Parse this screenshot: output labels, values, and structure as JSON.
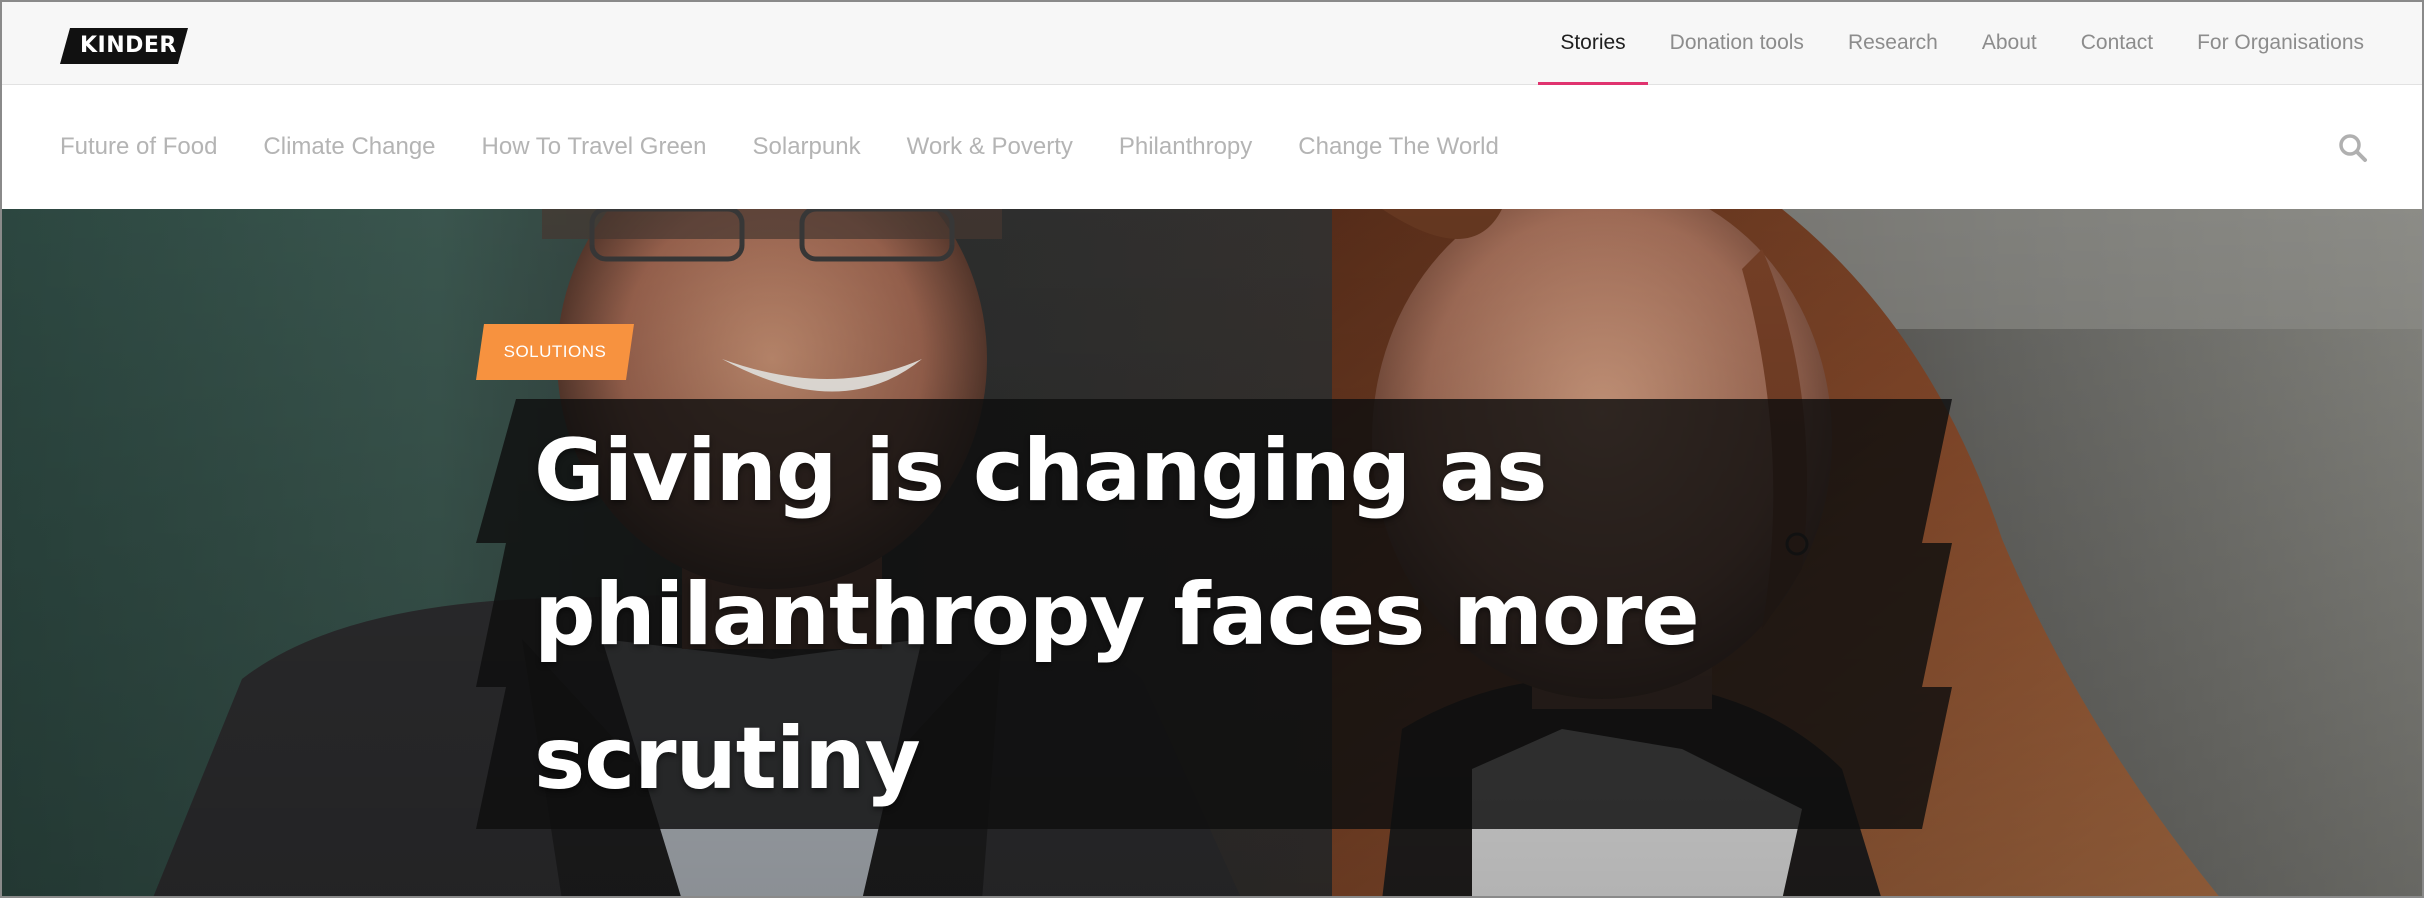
{
  "brand": {
    "logo_text": "KINDER"
  },
  "topnav": {
    "items": [
      {
        "label": "Stories",
        "active": true
      },
      {
        "label": "Donation tools",
        "active": false
      },
      {
        "label": "Research",
        "active": false
      },
      {
        "label": "About",
        "active": false
      },
      {
        "label": "Contact",
        "active": false
      },
      {
        "label": "For Organisations",
        "active": false
      }
    ]
  },
  "categories": {
    "items": [
      {
        "label": "Future of Food"
      },
      {
        "label": "Climate Change"
      },
      {
        "label": "How To Travel Green"
      },
      {
        "label": "Solarpunk"
      },
      {
        "label": "Work & Poverty"
      },
      {
        "label": "Philanthropy"
      },
      {
        "label": "Change The World"
      }
    ],
    "search_icon": "search-icon"
  },
  "hero": {
    "tag_label": "SOLUTIONS",
    "headline": "Giving is changing as philanthropy faces more scrutiny"
  },
  "colors": {
    "accent_pink": "#e0336f",
    "tag_orange": "#f7923f",
    "headline_box": "#0f0f0f"
  }
}
